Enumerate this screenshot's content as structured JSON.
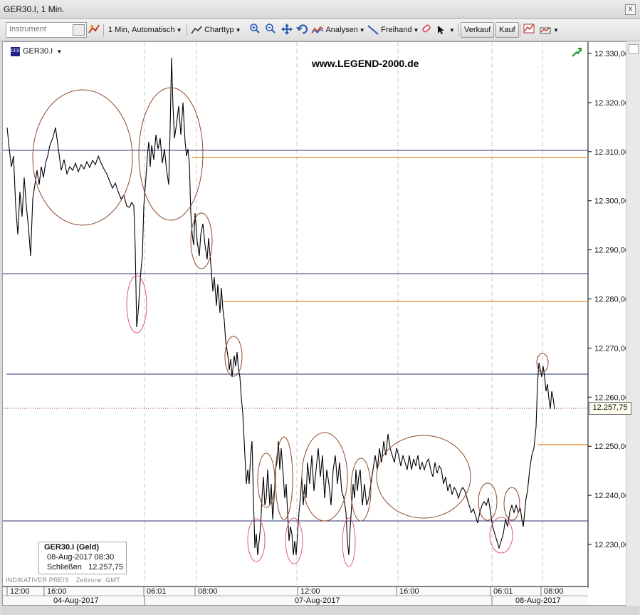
{
  "window": {
    "title": "GER30.I, 1 Min.",
    "close_label": "x"
  },
  "toolbar": {
    "instrument_placeholder": "Instrument",
    "interval_label": "1 Min,",
    "interval_mode": "Automatisch",
    "charttype_label": "Charttyp",
    "analysen_label": "Analysen",
    "freihand_label": "Freihand",
    "verkauf_label": "Verkauf",
    "kauf_label": "Kauf"
  },
  "chart": {
    "instrument": "GER30.I",
    "cfd_badge": "CFD",
    "watermark": "www.LEGEND-2000.de",
    "indicator_label": "INDIKATIVER PREIS",
    "timezone_label": "Zeitzone: GMT",
    "current_price": "12.257,75",
    "price_ticks": [
      "12.330,00",
      "12.320,00",
      "12.310,00",
      "12.300,00",
      "12.290,00",
      "12.280,00",
      "12.270,00",
      "12.260,00",
      "12.250,00",
      "12.240,00",
      "12.230,00"
    ],
    "time_ticks": [
      "12:00",
      "16:00",
      "06:01",
      "08:00",
      "12:00",
      "16:00",
      "06:01",
      "08:00"
    ],
    "date_labels": [
      "04-Aug-2017",
      "07-Aug-2017",
      "08-Aug-2017"
    ],
    "colors": {
      "line": "#000000",
      "support": "#2f2f7a",
      "resistance": "#e08a1e",
      "ellipse_brown": "#8a4a2a",
      "ellipse_pink": "#e05a7a",
      "price_marker": "#9b3030"
    }
  },
  "legend_box": {
    "title": "GER30.I (Geld)",
    "datetime": "08-Aug-2017 08:30",
    "close_label": "Schließen",
    "close_value": "12.257,75"
  }
}
